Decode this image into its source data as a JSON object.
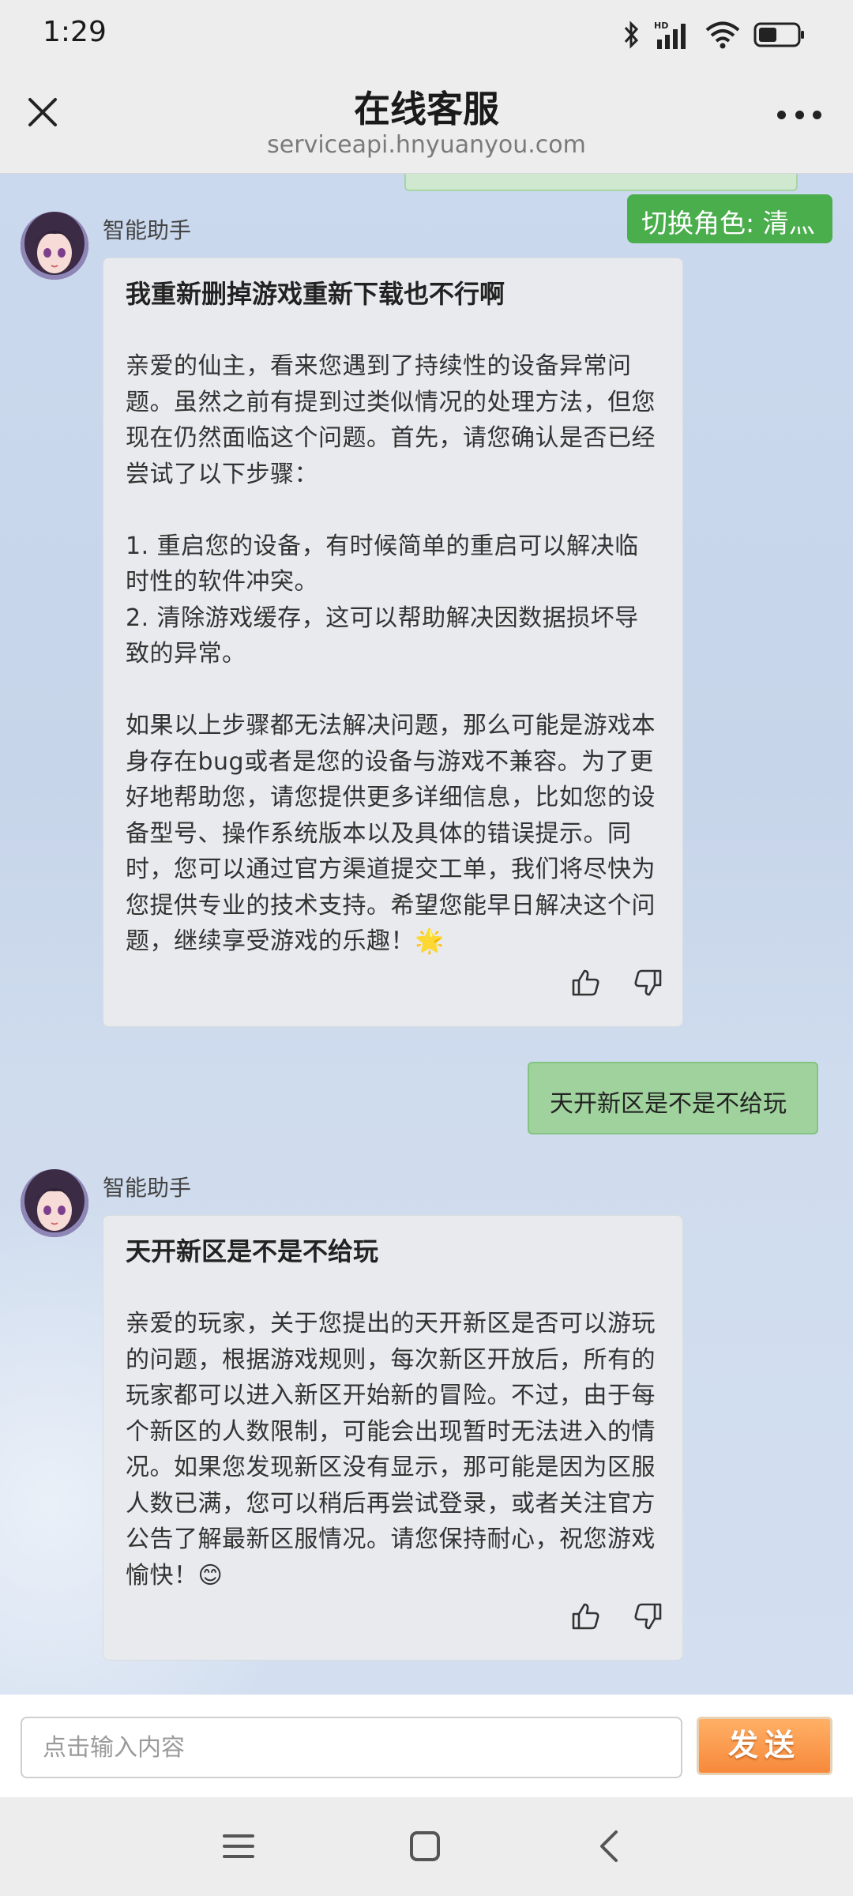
{
  "status_bar": {
    "time": "1:29"
  },
  "header": {
    "title": "在线客服",
    "url": "serviceapi.hnyuanyou.com"
  },
  "role_switch": {
    "label": "切换角色: 清灬"
  },
  "messages": [
    {
      "sender": "智能助手",
      "title": "我重新删掉游戏重新下载也不行啊",
      "body": "亲爱的仙主，看来您遇到了持续性的设备异常问题。虽然之前有提到过类似情况的处理方法，但您现在仍然面临这个问题。首先，请您确认是否已经尝试了以下步骤：\n\n1. 重启您的设备，有时候简单的重启可以解决临时性的软件冲突。\n2. 清除游戏缓存，这可以帮助解决因数据损坏导致的异常。\n\n如果以上步骤都无法解决问题，那么可能是游戏本身存在bug或者是您的设备与游戏不兼容。为了更好地帮助您，请您提供更多详细信息，比如您的设备型号、操作系统版本以及具体的错误提示。同时，您可以通过官方渠道提交工单，我们将尽快为您提供专业的技术支持。希望您能早日解决这个问题，继续享受游戏的乐趣！🌟"
    },
    {
      "user_text": "天开新区是不是不给玩"
    },
    {
      "sender": "智能助手",
      "title": "天开新区是不是不给玩",
      "body": "亲爱的玩家，关于您提出的天开新区是否可以游玩的问题，根据游戏规则，每次新区开放后，所有的玩家都可以进入新区开始新的冒险。不过，由于每个新区的人数限制，可能会出现暂时无法进入的情况。如果您发现新区没有显示，那可能是因为区服人数已满，您可以稍后再尝试登录，或者关注官方公告了解最新区服情况。请您保持耐心，祝您游戏愉快！😊"
    }
  ],
  "input": {
    "placeholder": "点击输入内容",
    "value": ""
  },
  "send_button": {
    "label": "发送"
  },
  "icons": {
    "close": "close-icon",
    "more": "more-icon",
    "like": "thumbs-up-icon",
    "dislike": "thumbs-down-icon",
    "nav_menu": "menu-icon",
    "nav_home": "home-icon",
    "nav_back": "back-icon"
  },
  "colors": {
    "accent_green": "#4aae4c",
    "user_bubble": "#9fd29c",
    "send_orange": "#f7893b",
    "chat_bg": "#c9d6ea"
  }
}
